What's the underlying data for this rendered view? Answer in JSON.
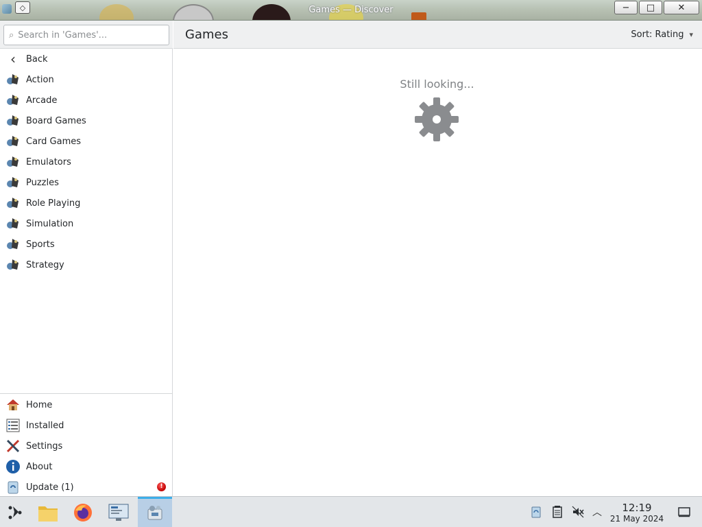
{
  "window": {
    "title": "Games — Discover",
    "buttons": {
      "minimize": "−",
      "maximize": "□",
      "close": "✕"
    }
  },
  "search": {
    "placeholder": "Search in 'Games'..."
  },
  "sidebar": {
    "categories": [
      {
        "label": "Back",
        "icon": "back-arrow-icon"
      },
      {
        "label": "Action",
        "icon": "games-category-icon"
      },
      {
        "label": "Arcade",
        "icon": "games-category-icon"
      },
      {
        "label": "Board Games",
        "icon": "games-category-icon"
      },
      {
        "label": "Card Games",
        "icon": "games-category-icon"
      },
      {
        "label": "Emulators",
        "icon": "games-category-icon"
      },
      {
        "label": "Puzzles",
        "icon": "games-category-icon"
      },
      {
        "label": "Role Playing",
        "icon": "games-category-icon"
      },
      {
        "label": "Simulation",
        "icon": "games-category-icon"
      },
      {
        "label": "Sports",
        "icon": "games-category-icon"
      },
      {
        "label": "Strategy",
        "icon": "games-category-icon"
      }
    ],
    "bottom": [
      {
        "label": "Home",
        "icon": "home-icon"
      },
      {
        "label": "Installed",
        "icon": "installed-list-icon"
      },
      {
        "label": "Settings",
        "icon": "settings-tools-icon"
      },
      {
        "label": "About",
        "icon": "info-icon"
      },
      {
        "label": "Update (1)",
        "icon": "update-icon",
        "badge": "!"
      }
    ]
  },
  "main": {
    "title": "Games",
    "sort_label": "Sort: Rating",
    "loading_text": "Still looking..."
  },
  "taskbar": {
    "apps": [
      "app-launcher-icon",
      "file-manager-icon",
      "firefox-icon",
      "system-monitor-icon",
      "discover-icon"
    ],
    "tray": [
      "clipboard-icon",
      "notes-icon",
      "volume-muted-icon",
      "tray-expand-icon"
    ],
    "clock": {
      "time": "12:19",
      "date": "21 May 2024"
    },
    "show_desktop": "show-desktop-icon"
  },
  "colors": {
    "accent": "#3daee9",
    "header_bg": "#eff0f1",
    "taskbar_bg": "#e3e6e9",
    "badge": "#d00000"
  }
}
